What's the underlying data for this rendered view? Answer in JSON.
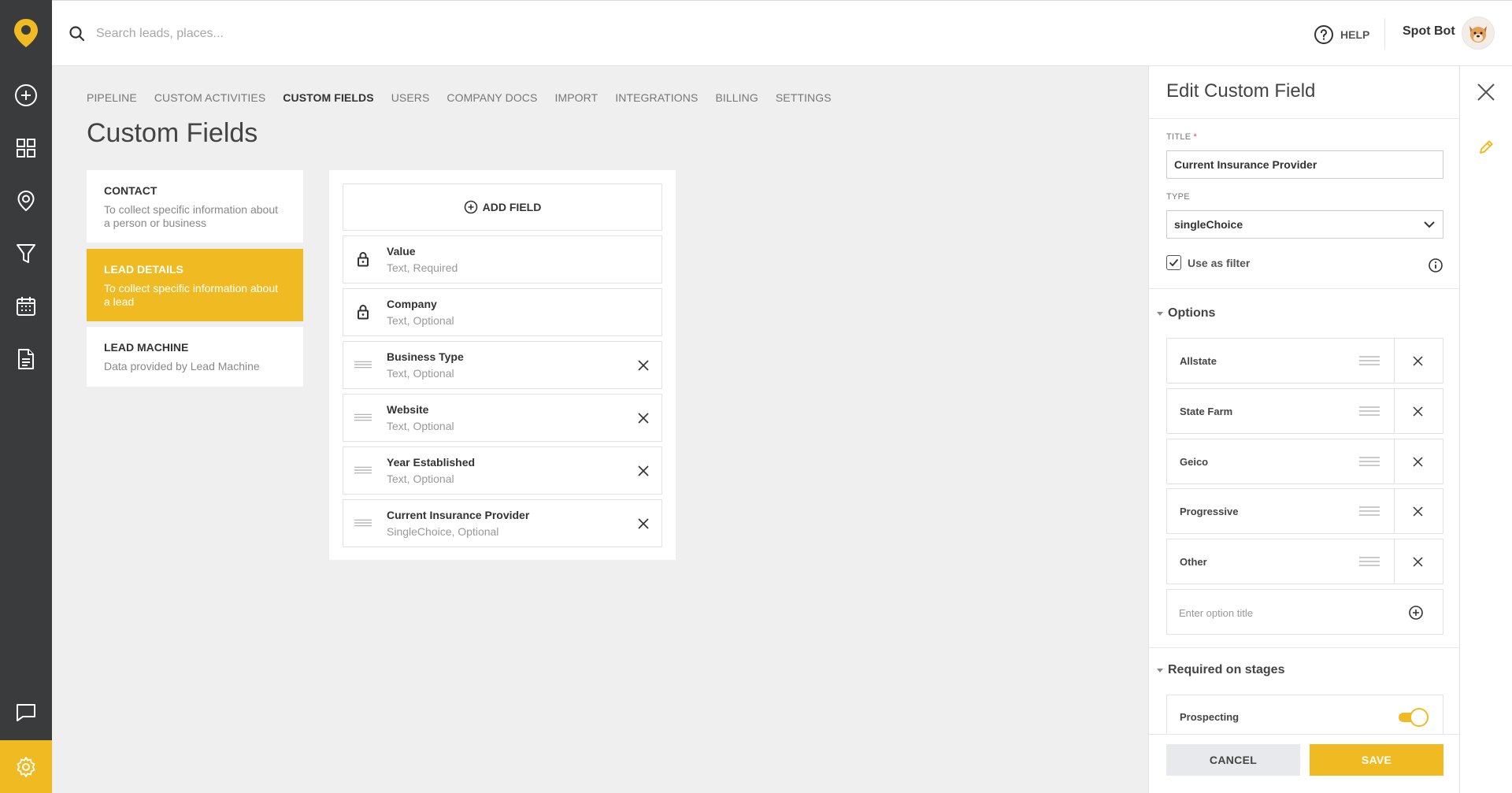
{
  "colors": {
    "accent": "#f0bb22",
    "sidebar": "#3a3b3d"
  },
  "sidebar": {
    "items": [
      {
        "icon": "plus-circle-icon"
      },
      {
        "icon": "grid-icon"
      },
      {
        "icon": "map-pin-icon"
      },
      {
        "icon": "funnel-icon"
      },
      {
        "icon": "calendar-icon"
      },
      {
        "icon": "document-icon"
      },
      {
        "icon": "chat-icon"
      },
      {
        "icon": "gear-icon"
      }
    ]
  },
  "topbar": {
    "search_placeholder": "Search leads, places...",
    "help_label": "HELP",
    "username": "Spot Bot"
  },
  "nav": {
    "tabs": [
      "PIPELINE",
      "CUSTOM ACTIVITIES",
      "CUSTOM FIELDS",
      "USERS",
      "COMPANY DOCS",
      "IMPORT",
      "INTEGRATIONS",
      "BILLING",
      "SETTINGS"
    ],
    "active": "CUSTOM FIELDS"
  },
  "page": {
    "title": "Custom Fields"
  },
  "categories": [
    {
      "title": "CONTACT",
      "desc": "To collect specific information about a person or business"
    },
    {
      "title": "LEAD DETAILS",
      "desc": "To collect specific information about a lead"
    },
    {
      "title": "LEAD MACHINE",
      "desc": "Data provided by Lead Machine"
    }
  ],
  "fields": {
    "add_label": "ADD FIELD",
    "items": [
      {
        "name": "Value",
        "meta": "Text, Required",
        "locked": true
      },
      {
        "name": "Company",
        "meta": "Text, Optional",
        "locked": true
      },
      {
        "name": "Business Type",
        "meta": "Text, Optional",
        "locked": false
      },
      {
        "name": "Website",
        "meta": "Text, Optional",
        "locked": false
      },
      {
        "name": "Year Established",
        "meta": "Text, Optional",
        "locked": false
      },
      {
        "name": "Current Insurance Provider",
        "meta": "SingleChoice, Optional",
        "locked": false
      }
    ]
  },
  "drawer": {
    "title": "Edit Custom Field",
    "title_label": "TITLE",
    "title_value": "Current Insurance Provider",
    "type_label": "TYPE",
    "type_value": "singleChoice",
    "filter_label": "Use as filter",
    "filter_checked": true,
    "options_heading": "Options",
    "options": [
      "Allstate",
      "State Farm",
      "Geico",
      "Progressive",
      "Other"
    ],
    "option_placeholder": "Enter option title",
    "stages_heading": "Required on stages",
    "stages": [
      {
        "name": "Prospecting",
        "on": true
      }
    ],
    "cancel_label": "CANCEL",
    "save_label": "SAVE"
  }
}
